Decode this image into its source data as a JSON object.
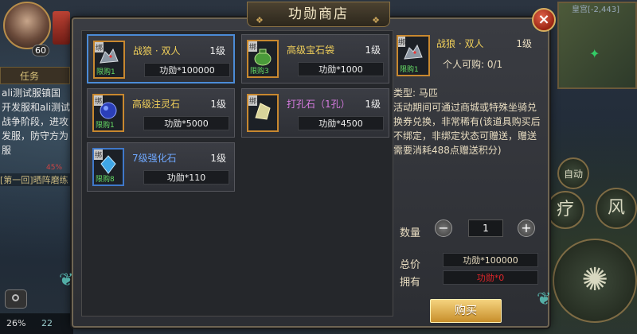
{
  "hud": {
    "player_level": "60",
    "tab_label": "任务",
    "chat_lines": [
      "ali测试服镇国",
      "开发服和ali测试",
      "战争阶段，进攻",
      "发服，防守方为",
      "服"
    ],
    "exp_percent": "45%",
    "quest_text": "[第一回]晒阵磨练",
    "battery": "26%",
    "bottom_value": "22",
    "map_coords": "皇宫[-2,443]",
    "skill_auto_label": "自动",
    "skill_1_label": "疗",
    "skill_2_label": "风"
  },
  "shop": {
    "title": "功勋商店",
    "close_label": "×",
    "items": [
      {
        "name": "战狼 · 双人",
        "name_color": "#f0cf5a",
        "level": "1级",
        "price": "功勋*100000",
        "bind_tag": "绑",
        "limit_tag": "限购1",
        "icon": "wolf-icon",
        "frame": "#c8882f"
      },
      {
        "name": "高级宝石袋",
        "name_color": "#f0cf5a",
        "level": "1级",
        "price": "功勋*1000",
        "bind_tag": "绑",
        "limit_tag": "限购3",
        "icon": "gem-bag-icon",
        "frame": "#c8882f"
      },
      {
        "name": "高级注灵石",
        "name_color": "#f0cf5a",
        "level": "1级",
        "price": "功勋*5000",
        "bind_tag": "绑",
        "limit_tag": "限购1",
        "icon": "spirit-stone-icon",
        "frame": "#c8882f"
      },
      {
        "name": "打孔石（1孔）",
        "name_color": "#d77be0",
        "level": "1级",
        "price": "功勋*4500",
        "bind_tag": "绑",
        "limit_tag": "",
        "icon": "punch-stone-icon",
        "frame": "#c8882f"
      },
      {
        "name": "7级强化石",
        "name_color": "#6fa8ff",
        "level": "1级",
        "price": "功勋*110",
        "bind_tag": "绑",
        "limit_tag": "限购8",
        "icon": "enhance-stone-icon",
        "frame": "#3f78c9"
      }
    ],
    "detail": {
      "name": "战狼 · 双人",
      "level": "1级",
      "bind_tag": "绑",
      "limit_tag": "限购1",
      "personal_buy": "个人可购: 0/1",
      "type": "类型: 马匹",
      "description": "活动期间可通过商城或特殊坐骑兑换券兑换，非常稀有(该道具购买后不绑定，非绑定状态可赠送，赠送需要消耗488点赠送积分)",
      "quantity_label": "数量",
      "quantity_minus": "−",
      "quantity_plus": "+",
      "quantity_value": "1",
      "total_label": "总价",
      "total_value": "功勋*100000",
      "own_label": "拥有",
      "own_value": "功勋*0",
      "buy_label": "购买"
    }
  },
  "colors": {
    "accent": "#4b8bd6",
    "gold": "#f0cf5a",
    "purple": "#d77be0",
    "blue": "#6fa8ff",
    "red": "#e0262a"
  }
}
